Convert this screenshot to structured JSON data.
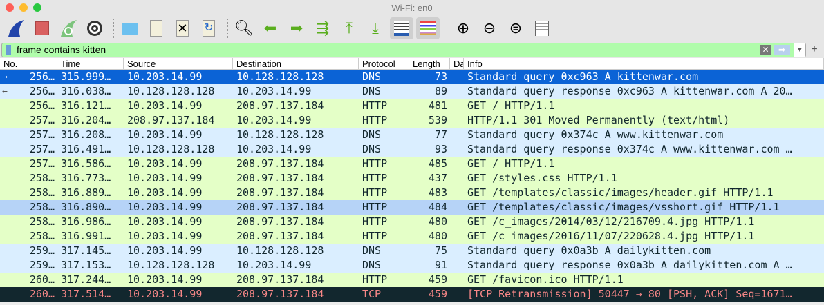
{
  "window": {
    "title": "Wi-Fi: en0"
  },
  "toolbar": [
    "shark-fin-icon",
    "stop-icon",
    "restart-icon",
    "options-gear-icon",
    "open-folder-icon",
    "save-file-icon",
    "close-file-icon",
    "reload-file-icon",
    "find-icon",
    "go-back-icon",
    "go-forward-icon",
    "go-to-packet-icon",
    "first-packet-icon",
    "last-packet-icon",
    "autoscroll-icon",
    "colorize-icon",
    "zoom-in-icon",
    "zoom-out-icon",
    "normal-size-icon",
    "resize-columns-icon"
  ],
  "filter": {
    "value": "frame contains kitten"
  },
  "columns": [
    "No.",
    "Time",
    "Source",
    "Destination",
    "Protocol",
    "Length",
    "Da",
    "Info"
  ],
  "rows": [
    {
      "no": "256…",
      "time": "315.999…",
      "src": "10.203.14.99",
      "dst": "10.128.128.128",
      "proto": "DNS",
      "len": "73",
      "info": "Standard query 0xc963 A kittenwar.com",
      "style": "sel",
      "mark": "→"
    },
    {
      "no": "256…",
      "time": "316.038…",
      "src": "10.128.128.128",
      "dst": "10.203.14.99",
      "proto": "DNS",
      "len": "89",
      "info": "Standard query response 0xc963 A kittenwar.com A 20…",
      "style": "dns",
      "mark": "←"
    },
    {
      "no": "256…",
      "time": "316.121…",
      "src": "10.203.14.99",
      "dst": "208.97.137.184",
      "proto": "HTTP",
      "len": "481",
      "info": "GET / HTTP/1.1",
      "style": "http"
    },
    {
      "no": "257…",
      "time": "316.204…",
      "src": "208.97.137.184",
      "dst": "10.203.14.99",
      "proto": "HTTP",
      "len": "539",
      "info": "HTTP/1.1 301 Moved Permanently  (text/html)",
      "style": "http"
    },
    {
      "no": "257…",
      "time": "316.208…",
      "src": "10.203.14.99",
      "dst": "10.128.128.128",
      "proto": "DNS",
      "len": "77",
      "info": "Standard query 0x374c A www.kittenwar.com",
      "style": "dns"
    },
    {
      "no": "257…",
      "time": "316.491…",
      "src": "10.128.128.128",
      "dst": "10.203.14.99",
      "proto": "DNS",
      "len": "93",
      "info": "Standard query response 0x374c A www.kittenwar.com …",
      "style": "dns"
    },
    {
      "no": "257…",
      "time": "316.586…",
      "src": "10.203.14.99",
      "dst": "208.97.137.184",
      "proto": "HTTP",
      "len": "485",
      "info": "GET / HTTP/1.1",
      "style": "http"
    },
    {
      "no": "258…",
      "time": "316.773…",
      "src": "10.203.14.99",
      "dst": "208.97.137.184",
      "proto": "HTTP",
      "len": "437",
      "info": "GET /styles.css HTTP/1.1",
      "style": "http"
    },
    {
      "no": "258…",
      "time": "316.889…",
      "src": "10.203.14.99",
      "dst": "208.97.137.184",
      "proto": "HTTP",
      "len": "483",
      "info": "GET /templates/classic/images/header.gif HTTP/1.1",
      "style": "http"
    },
    {
      "no": "258…",
      "time": "316.890…",
      "src": "10.203.14.99",
      "dst": "208.97.137.184",
      "proto": "HTTP",
      "len": "484",
      "info": "GET /templates/classic/images/vsshort.gif HTTP/1.1",
      "style": "rel"
    },
    {
      "no": "258…",
      "time": "316.986…",
      "src": "10.203.14.99",
      "dst": "208.97.137.184",
      "proto": "HTTP",
      "len": "480",
      "info": "GET /c_images/2014/03/12/216709.4.jpg HTTP/1.1",
      "style": "http"
    },
    {
      "no": "258…",
      "time": "316.991…",
      "src": "10.203.14.99",
      "dst": "208.97.137.184",
      "proto": "HTTP",
      "len": "480",
      "info": "GET /c_images/2016/11/07/220628.4.jpg HTTP/1.1",
      "style": "http"
    },
    {
      "no": "259…",
      "time": "317.145…",
      "src": "10.203.14.99",
      "dst": "10.128.128.128",
      "proto": "DNS",
      "len": "75",
      "info": "Standard query 0x0a3b A dailykitten.com",
      "style": "dns"
    },
    {
      "no": "259…",
      "time": "317.153…",
      "src": "10.128.128.128",
      "dst": "10.203.14.99",
      "proto": "DNS",
      "len": "91",
      "info": "Standard query response 0x0a3b A dailykitten.com A …",
      "style": "dns"
    },
    {
      "no": "260…",
      "time": "317.244…",
      "src": "10.203.14.99",
      "dst": "208.97.137.184",
      "proto": "HTTP",
      "len": "459",
      "info": "GET /favicon.ico HTTP/1.1",
      "style": "http"
    },
    {
      "no": "260…",
      "time": "317.514…",
      "src": "10.203.14.99",
      "dst": "208.97.137.184",
      "proto": "TCP",
      "len": "459",
      "info": "[TCP Retransmission] 50447 → 80 [PSH, ACK] Seq=1671…",
      "style": "tcp"
    }
  ]
}
